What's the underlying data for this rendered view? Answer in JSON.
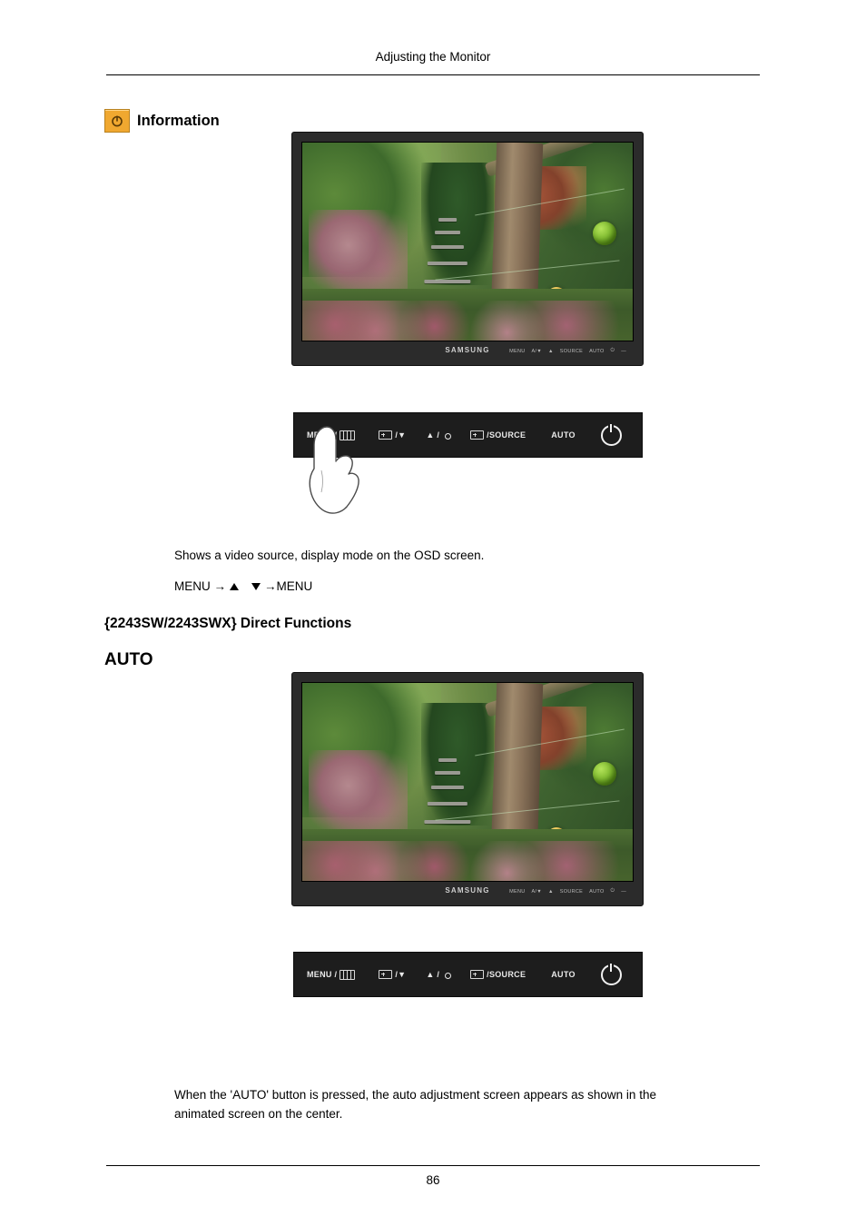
{
  "header": {
    "title": "Adjusting the Monitor"
  },
  "information": {
    "icon": "power-info-icon",
    "label": "Information"
  },
  "monitor_top": {
    "brand": "SAMSUNG",
    "bezel_keys": [
      "MENU",
      "A/▼",
      "▲",
      "SOURCE",
      "AUTO",
      "⏻",
      "—"
    ]
  },
  "control_bar_top": {
    "buttons": [
      {
        "name": "menu-button",
        "label": "MENU /",
        "icon": "menu-grid-icon"
      },
      {
        "name": "source-down-button",
        "label": "/▼",
        "icon": "enter-box-icon"
      },
      {
        "name": "up-brightness-button",
        "label": "▲ /",
        "icon": "brightness-icon"
      },
      {
        "name": "source-button",
        "label": "/SOURCE",
        "icon": "enter-box-icon"
      },
      {
        "name": "auto-button",
        "label": "AUTO",
        "icon": ""
      },
      {
        "name": "power-button",
        "label": "",
        "icon": "power-icon"
      },
      {
        "name": "power-led",
        "label": "",
        "icon": "led-indicator"
      }
    ]
  },
  "body": {
    "paragraph1": "Shows a video source, display mode on the OSD screen.",
    "menu_sequence": {
      "start": "MENU →",
      "middle": "",
      "end": "→MENU"
    },
    "section_heading": "{2243SW/2243SWX} Direct Functions",
    "auto_heading": "AUTO",
    "paragraph2_line1": "When the 'AUTO' button is pressed, the auto adjustment screen appears as shown in the",
    "paragraph2_line2": "animated screen on the center."
  },
  "monitor_bottom": {
    "brand": "SAMSUNG",
    "bezel_keys": [
      "MENU",
      "A/▼",
      "▲",
      "SOURCE",
      "AUTO",
      "⏻",
      "—"
    ]
  },
  "control_bar_bottom": {
    "buttons": [
      {
        "name": "menu-button",
        "label": "MENU /",
        "icon": "menu-grid-icon"
      },
      {
        "name": "source-down-button",
        "label": "/▼",
        "icon": "enter-box-icon"
      },
      {
        "name": "up-brightness-button",
        "label": "▲ /",
        "icon": "brightness-icon"
      },
      {
        "name": "source-button",
        "label": "/SOURCE",
        "icon": "enter-box-icon"
      },
      {
        "name": "auto-button",
        "label": "AUTO",
        "icon": ""
      },
      {
        "name": "power-button",
        "label": "",
        "icon": "power-icon"
      },
      {
        "name": "power-led",
        "label": "",
        "icon": "led-indicator"
      }
    ]
  },
  "footer": {
    "page_number": "86"
  },
  "colors": {
    "info_icon": "#f0a830",
    "led": "#3b7fe0",
    "bezel": "#2b2b2b",
    "control_bar": "#1d1d1d"
  }
}
